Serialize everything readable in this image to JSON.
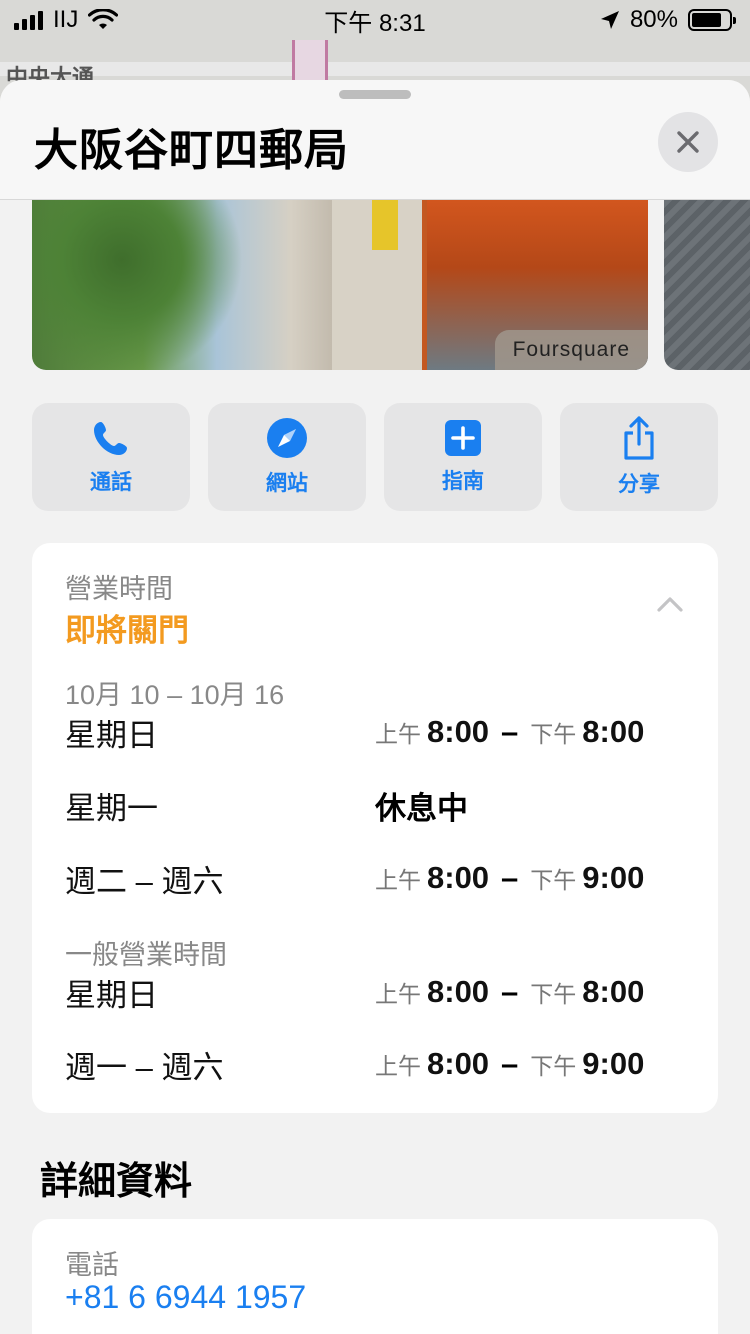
{
  "status_bar": {
    "carrier": "IIJ",
    "time": "下午 8:31",
    "battery": "80%",
    "battery_level": 0.8
  },
  "map": {
    "street_label": "中央大通"
  },
  "place": {
    "title": "大阪谷町四郵局",
    "photo_credit": "Foursquare"
  },
  "actions": [
    {
      "label": "通話",
      "icon": "phone-icon"
    },
    {
      "label": "網站",
      "icon": "compass-icon"
    },
    {
      "label": "指南",
      "icon": "plus-square-icon"
    },
    {
      "label": "分享",
      "icon": "share-icon"
    }
  ],
  "hours": {
    "header": "營業時間",
    "status": "即將關門",
    "special_range": "10月 10 – 10月 16",
    "special_rows": [
      {
        "day": "星期日",
        "open_period": "上午",
        "open": "8:00",
        "close_period": "下午",
        "close": "8:00"
      },
      {
        "day": "星期一",
        "closed": "休息中"
      },
      {
        "day": "週二 – 週六",
        "open_period": "上午",
        "open": "8:00",
        "close_period": "下午",
        "close": "9:00"
      }
    ],
    "regular_header": "一般營業時間",
    "regular_rows": [
      {
        "day": "星期日",
        "open_period": "上午",
        "open": "8:00",
        "close_period": "下午",
        "close": "8:00"
      },
      {
        "day": "週一 – 週六",
        "open_period": "上午",
        "open": "8:00",
        "close_period": "下午",
        "close": "9:00"
      }
    ]
  },
  "details": {
    "title": "詳細資料",
    "phone_label": "電話",
    "phone": "+81 6 6944 1957"
  },
  "colors": {
    "accent": "#1a7ff0",
    "closing": "#f39a1f"
  }
}
